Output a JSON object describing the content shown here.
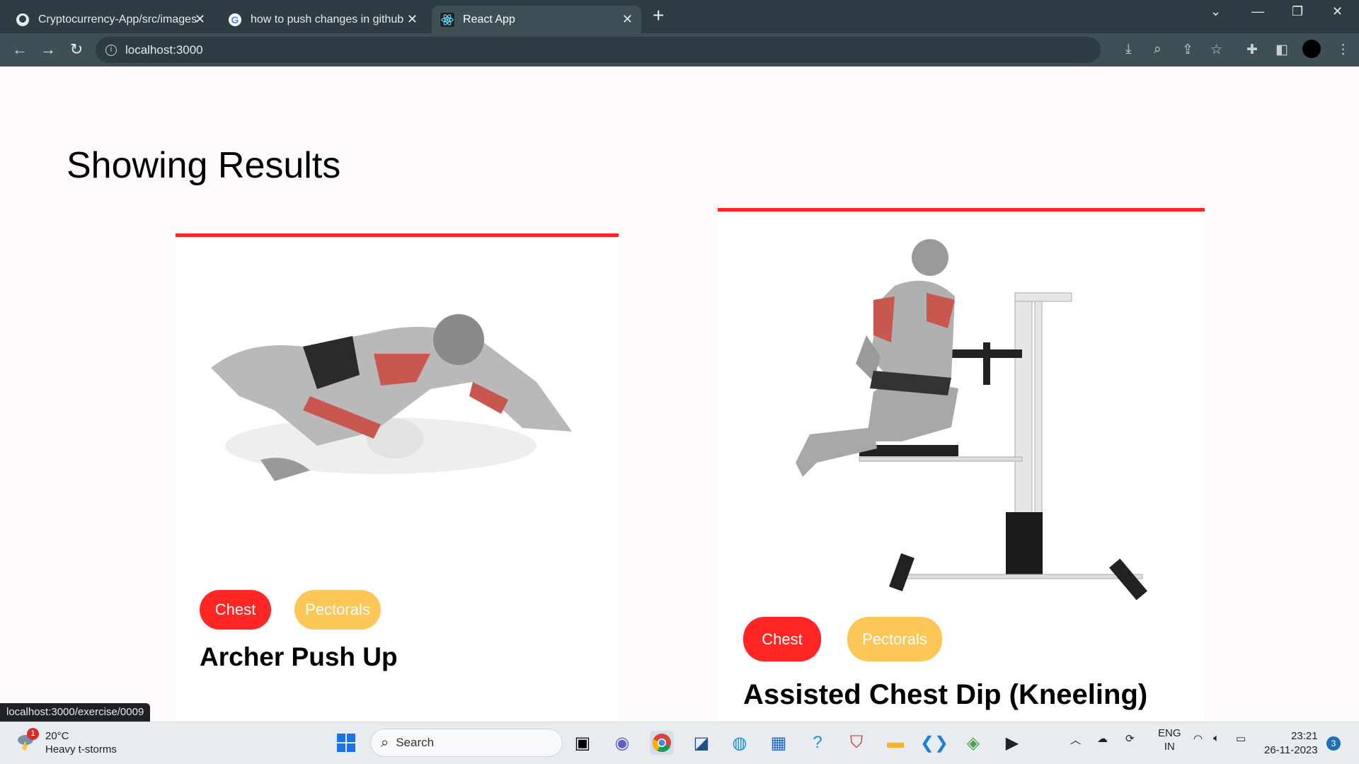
{
  "browser": {
    "tabs": [
      {
        "title": "Cryptocurrency-App/src/images",
        "icon": "github-icon"
      },
      {
        "title": "how to push changes in github",
        "icon": "google-icon"
      },
      {
        "title": "React App",
        "icon": "react-icon",
        "active": true
      }
    ],
    "address": "localhost:3000",
    "status_url": "localhost:3000/exercise/0009"
  },
  "page": {
    "heading": "Showing Results",
    "exercises": [
      {
        "name": "Archer Push Up",
        "body_part": "Chest",
        "target": "Pectorals"
      },
      {
        "name": "Assisted Chest Dip (Kneeling)",
        "body_part": "Chest",
        "target": "Pectorals"
      }
    ],
    "colors": {
      "accent": "#ff2625",
      "target_pill": "#fcc757"
    }
  },
  "taskbar": {
    "weather_temp": "20°C",
    "weather_desc": "Heavy t-storms",
    "weather_badge": "1",
    "search_label": "Search",
    "lang_top": "ENG",
    "lang_bottom": "IN",
    "time": "23:21",
    "date": "26-11-2023",
    "notification_count": "3"
  }
}
